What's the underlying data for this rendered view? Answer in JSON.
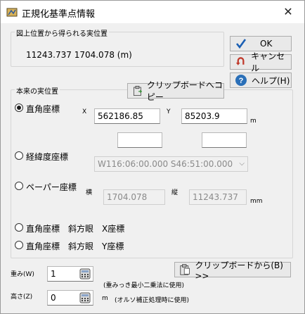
{
  "window": {
    "title": "正規化基準点情報",
    "close_glyph": "✕"
  },
  "map_position": {
    "legend": "図上位置から得られる実位置",
    "value": "11243.737    1704.078 (m)"
  },
  "buttons": {
    "ok": "OK",
    "cancel": "キャンセル",
    "help": "ヘルプ(H)",
    "copy_to_clipboard": "クリップボードへコピー",
    "paste_from_clipboard": "クリップボードから(B) >>"
  },
  "actual_position": {
    "legend": "本来の実位置",
    "rect": {
      "label": "直角座標",
      "x_label": "X",
      "y_label": "Y",
      "x_value": "562186.85",
      "y_value": "85203.9",
      "unit": "m"
    },
    "latlon": {
      "label": "経緯度座標",
      "value": "W116:06:00.000 S46:51:00.000"
    },
    "paper": {
      "label": "ペーパー座標",
      "h_label": "横",
      "v_label": "縦",
      "h_value": "1704.078",
      "v_value": "11243.737",
      "unit": "mm"
    },
    "oblique_x": "直角座標　斜方眼　X座標",
    "oblique_y": "直角座標　斜方眼　Y座標"
  },
  "weight": {
    "label": "重み(W)",
    "value": "1",
    "note": "(重みっき最小二乗法に使用)"
  },
  "height": {
    "label": "高さ(Z)",
    "value": "0",
    "unit": "m",
    "note": "(オルソ補正処理時に使用)"
  },
  "colors": {
    "accent": "#1a5fb4",
    "cancel_red": "#c0392b",
    "help_blue": "#2a6fb8"
  }
}
